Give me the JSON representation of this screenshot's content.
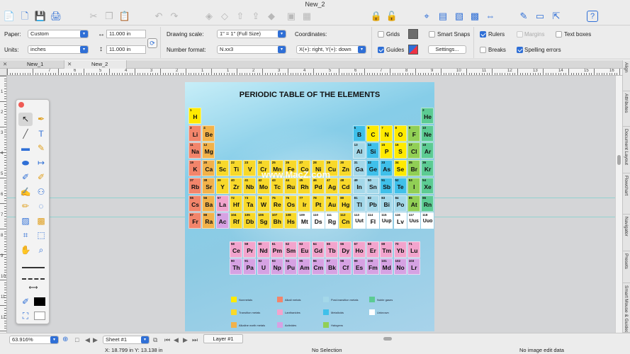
{
  "window": {
    "title": "New_2"
  },
  "props": {
    "paper_label": "Paper:",
    "paper_value": "Custom",
    "width_value": "11.000 in",
    "height_value": "11.000 in",
    "units_label": "Units:",
    "units_value": "inches",
    "drawing_scale_label": "Drawing scale:",
    "drawing_scale_value": "1\" = 1\"   (Full Size)",
    "number_format_label": "Number format:",
    "number_format_value": "N.xx3",
    "coordinates_label": "Coordinates:",
    "coordinates_value": "X(+): right, Y(+): down",
    "grids_label": "Grids",
    "guides_label": "Guides",
    "smart_snaps_label": "Smart Snaps",
    "settings_label": "Settings...",
    "rulers_label": "Rulers",
    "margins_label": "Margins",
    "breaks_label": "Breaks",
    "text_boxes_label": "Text boxes",
    "spelling_label": "Spelling errors",
    "grids_checked": false,
    "guides_checked": true,
    "smart_snaps_checked": false,
    "rulers_checked": true,
    "margins_checked": false,
    "breaks_checked": false,
    "text_boxes_checked": false,
    "spelling_checked": true
  },
  "tabs": [
    {
      "label": "New_1"
    },
    {
      "label": "New_2"
    }
  ],
  "ruler_numbers": [
    "7",
    "6",
    "5",
    "4",
    "3",
    "2",
    "1",
    "1",
    "2",
    "3",
    "4",
    "5",
    "6",
    "7",
    "8",
    "9",
    "10",
    "11",
    "12",
    "13",
    "14",
    "15",
    "16",
    "17",
    "18"
  ],
  "vruler_numbers": [
    "1",
    "2",
    "3",
    "4",
    "5",
    "6",
    "7",
    "8",
    "9",
    "10",
    "11",
    "12"
  ],
  "right_panel": [
    "Align",
    "Attributes",
    "Document Layout",
    "Flowchart",
    "Navigator",
    "Presets",
    "Smart Mouse & Guides"
  ],
  "poster": {
    "title": "PERIODIC TABLE OF THE ELEMENTS",
    "watermark": "www.MacZ.com",
    "colors": {
      "alkali": "#f2856b",
      "alkaline": "#f2b24a",
      "transition": "#f8d92a",
      "post": "#a4d8e9",
      "metalloid": "#3fc0ea",
      "nonmetal": "#ffea00",
      "halogen": "#91cf55",
      "noble": "#5ccb93",
      "lanth": "#f2a4cd",
      "actin": "#d6a2e3",
      "unknown": "#ffffff"
    },
    "elements": [
      {
        "n": "1",
        "s": "H",
        "c": "nonmetal",
        "r": 1,
        "g": 1
      },
      {
        "n": "2",
        "s": "He",
        "c": "noble",
        "r": 1,
        "g": 18
      },
      {
        "n": "3",
        "s": "Li",
        "c": "alkali",
        "r": 2,
        "g": 1
      },
      {
        "n": "4",
        "s": "Be",
        "c": "alkaline",
        "r": 2,
        "g": 2
      },
      {
        "n": "5",
        "s": "B",
        "c": "metalloid",
        "r": 2,
        "g": 13
      },
      {
        "n": "6",
        "s": "C",
        "c": "nonmetal",
        "r": 2,
        "g": 14
      },
      {
        "n": "7",
        "s": "N",
        "c": "nonmetal",
        "r": 2,
        "g": 15
      },
      {
        "n": "8",
        "s": "O",
        "c": "nonmetal",
        "r": 2,
        "g": 16
      },
      {
        "n": "9",
        "s": "F",
        "c": "halogen",
        "r": 2,
        "g": 17
      },
      {
        "n": "10",
        "s": "Ne",
        "c": "noble",
        "r": 2,
        "g": 18
      },
      {
        "n": "11",
        "s": "Na",
        "c": "alkali",
        "r": 3,
        "g": 1
      },
      {
        "n": "12",
        "s": "Mg",
        "c": "alkaline",
        "r": 3,
        "g": 2
      },
      {
        "n": "13",
        "s": "Al",
        "c": "post",
        "r": 3,
        "g": 13
      },
      {
        "n": "14",
        "s": "Si",
        "c": "metalloid",
        "r": 3,
        "g": 14
      },
      {
        "n": "15",
        "s": "P",
        "c": "nonmetal",
        "r": 3,
        "g": 15
      },
      {
        "n": "16",
        "s": "S",
        "c": "nonmetal",
        "r": 3,
        "g": 16
      },
      {
        "n": "17",
        "s": "Cl",
        "c": "halogen",
        "r": 3,
        "g": 17
      },
      {
        "n": "18",
        "s": "Ar",
        "c": "noble",
        "r": 3,
        "g": 18
      },
      {
        "n": "19",
        "s": "K",
        "c": "alkali",
        "r": 4,
        "g": 1
      },
      {
        "n": "20",
        "s": "Ca",
        "c": "alkaline",
        "r": 4,
        "g": 2
      },
      {
        "n": "21",
        "s": "Sc",
        "c": "transition",
        "r": 4,
        "g": 3
      },
      {
        "n": "22",
        "s": "Ti",
        "c": "transition",
        "r": 4,
        "g": 4
      },
      {
        "n": "23",
        "s": "V",
        "c": "transition",
        "r": 4,
        "g": 5
      },
      {
        "n": "24",
        "s": "Cr",
        "c": "transition",
        "r": 4,
        "g": 6
      },
      {
        "n": "25",
        "s": "Mn",
        "c": "transition",
        "r": 4,
        "g": 7
      },
      {
        "n": "26",
        "s": "Fe",
        "c": "transition",
        "r": 4,
        "g": 8
      },
      {
        "n": "27",
        "s": "Co",
        "c": "transition",
        "r": 4,
        "g": 9
      },
      {
        "n": "28",
        "s": "Ni",
        "c": "transition",
        "r": 4,
        "g": 10
      },
      {
        "n": "29",
        "s": "Cu",
        "c": "transition",
        "r": 4,
        "g": 11
      },
      {
        "n": "30",
        "s": "Zn",
        "c": "transition",
        "r": 4,
        "g": 12
      },
      {
        "n": "31",
        "s": "Ga",
        "c": "post",
        "r": 4,
        "g": 13
      },
      {
        "n": "32",
        "s": "Ge",
        "c": "metalloid",
        "r": 4,
        "g": 14
      },
      {
        "n": "33",
        "s": "As",
        "c": "metalloid",
        "r": 4,
        "g": 15
      },
      {
        "n": "34",
        "s": "Se",
        "c": "nonmetal",
        "r": 4,
        "g": 16
      },
      {
        "n": "35",
        "s": "Br",
        "c": "halogen",
        "r": 4,
        "g": 17
      },
      {
        "n": "36",
        "s": "Kr",
        "c": "noble",
        "r": 4,
        "g": 18
      },
      {
        "n": "37",
        "s": "Rb",
        "c": "alkali",
        "r": 5,
        "g": 1
      },
      {
        "n": "38",
        "s": "Sr",
        "c": "alkaline",
        "r": 5,
        "g": 2
      },
      {
        "n": "39",
        "s": "Y",
        "c": "transition",
        "r": 5,
        "g": 3
      },
      {
        "n": "40",
        "s": "Zr",
        "c": "transition",
        "r": 5,
        "g": 4
      },
      {
        "n": "41",
        "s": "Nb",
        "c": "transition",
        "r": 5,
        "g": 5
      },
      {
        "n": "42",
        "s": "Mo",
        "c": "transition",
        "r": 5,
        "g": 6
      },
      {
        "n": "43",
        "s": "Tc",
        "c": "transition",
        "r": 5,
        "g": 7
      },
      {
        "n": "44",
        "s": "Ru",
        "c": "transition",
        "r": 5,
        "g": 8
      },
      {
        "n": "45",
        "s": "Rh",
        "c": "transition",
        "r": 5,
        "g": 9
      },
      {
        "n": "46",
        "s": "Pd",
        "c": "transition",
        "r": 5,
        "g": 10
      },
      {
        "n": "47",
        "s": "Ag",
        "c": "transition",
        "r": 5,
        "g": 11
      },
      {
        "n": "48",
        "s": "Cd",
        "c": "transition",
        "r": 5,
        "g": 12
      },
      {
        "n": "49",
        "s": "In",
        "c": "post",
        "r": 5,
        "g": 13
      },
      {
        "n": "50",
        "s": "Sn",
        "c": "post",
        "r": 5,
        "g": 14
      },
      {
        "n": "51",
        "s": "Sb",
        "c": "metalloid",
        "r": 5,
        "g": 15
      },
      {
        "n": "52",
        "s": "Te",
        "c": "metalloid",
        "r": 5,
        "g": 16
      },
      {
        "n": "53",
        "s": "I",
        "c": "halogen",
        "r": 5,
        "g": 17
      },
      {
        "n": "54",
        "s": "Xe",
        "c": "noble",
        "r": 5,
        "g": 18
      },
      {
        "n": "55",
        "s": "Cs",
        "c": "alkali",
        "r": 6,
        "g": 1
      },
      {
        "n": "56",
        "s": "Ba",
        "c": "alkaline",
        "r": 6,
        "g": 2
      },
      {
        "n": "57",
        "s": "La",
        "c": "lanth",
        "r": 6,
        "g": 3
      },
      {
        "n": "72",
        "s": "Hf",
        "c": "transition",
        "r": 6,
        "g": 4
      },
      {
        "n": "73",
        "s": "Ta",
        "c": "transition",
        "r": 6,
        "g": 5
      },
      {
        "n": "74",
        "s": "W",
        "c": "transition",
        "r": 6,
        "g": 6
      },
      {
        "n": "75",
        "s": "Re",
        "c": "transition",
        "r": 6,
        "g": 7
      },
      {
        "n": "76",
        "s": "Os",
        "c": "transition",
        "r": 6,
        "g": 8
      },
      {
        "n": "77",
        "s": "Ir",
        "c": "transition",
        "r": 6,
        "g": 9
      },
      {
        "n": "78",
        "s": "Pt",
        "c": "transition",
        "r": 6,
        "g": 10
      },
      {
        "n": "79",
        "s": "Au",
        "c": "transition",
        "r": 6,
        "g": 11
      },
      {
        "n": "80",
        "s": "Hg",
        "c": "transition",
        "r": 6,
        "g": 12
      },
      {
        "n": "81",
        "s": "Tl",
        "c": "post",
        "r": 6,
        "g": 13
      },
      {
        "n": "82",
        "s": "Pb",
        "c": "post",
        "r": 6,
        "g": 14
      },
      {
        "n": "83",
        "s": "Bi",
        "c": "post",
        "r": 6,
        "g": 15
      },
      {
        "n": "84",
        "s": "Po",
        "c": "post",
        "r": 6,
        "g": 16
      },
      {
        "n": "85",
        "s": "At",
        "c": "halogen",
        "r": 6,
        "g": 17
      },
      {
        "n": "86",
        "s": "Rn",
        "c": "noble",
        "r": 6,
        "g": 18
      },
      {
        "n": "87",
        "s": "Fr",
        "c": "alkali",
        "r": 7,
        "g": 1
      },
      {
        "n": "88",
        "s": "Ra",
        "c": "alkaline",
        "r": 7,
        "g": 2
      },
      {
        "n": "89",
        "s": "Ac",
        "c": "actin",
        "r": 7,
        "g": 3
      },
      {
        "n": "104",
        "s": "Rf",
        "c": "transition",
        "r": 7,
        "g": 4
      },
      {
        "n": "105",
        "s": "Db",
        "c": "transition",
        "r": 7,
        "g": 5
      },
      {
        "n": "106",
        "s": "Sg",
        "c": "transition",
        "r": 7,
        "g": 6
      },
      {
        "n": "107",
        "s": "Bh",
        "c": "transition",
        "r": 7,
        "g": 7
      },
      {
        "n": "108",
        "s": "Hs",
        "c": "transition",
        "r": 7,
        "g": 8
      },
      {
        "n": "109",
        "s": "Mt",
        "c": "unknown",
        "r": 7,
        "g": 9
      },
      {
        "n": "110",
        "s": "Ds",
        "c": "unknown",
        "r": 7,
        "g": 10
      },
      {
        "n": "111",
        "s": "Rg",
        "c": "unknown",
        "r": 7,
        "g": 11
      },
      {
        "n": "112",
        "s": "Cn",
        "c": "transition",
        "r": 7,
        "g": 12
      },
      {
        "n": "113",
        "s": "Uut",
        "c": "unknown",
        "r": 7,
        "g": 13
      },
      {
        "n": "114",
        "s": "Fl",
        "c": "unknown",
        "r": 7,
        "g": 14
      },
      {
        "n": "115",
        "s": "Uup",
        "c": "unknown",
        "r": 7,
        "g": 15
      },
      {
        "n": "116",
        "s": "Lv",
        "c": "unknown",
        "r": 7,
        "g": 16
      },
      {
        "n": "117",
        "s": "Uus",
        "c": "unknown",
        "r": 7,
        "g": 17
      },
      {
        "n": "118",
        "s": "Uuo",
        "c": "unknown",
        "r": 7,
        "g": 18
      },
      {
        "n": "58",
        "s": "Ce",
        "c": "lanth",
        "r": 9,
        "g": 4
      },
      {
        "n": "59",
        "s": "Pr",
        "c": "lanth",
        "r": 9,
        "g": 5
      },
      {
        "n": "60",
        "s": "Nd",
        "c": "lanth",
        "r": 9,
        "g": 6
      },
      {
        "n": "61",
        "s": "Pm",
        "c": "lanth",
        "r": 9,
        "g": 7
      },
      {
        "n": "62",
        "s": "Sm",
        "c": "lanth",
        "r": 9,
        "g": 8
      },
      {
        "n": "63",
        "s": "Eu",
        "c": "lanth",
        "r": 9,
        "g": 9
      },
      {
        "n": "64",
        "s": "Gd",
        "c": "lanth",
        "r": 9,
        "g": 10
      },
      {
        "n": "65",
        "s": "Tb",
        "c": "lanth",
        "r": 9,
        "g": 11
      },
      {
        "n": "66",
        "s": "Dy",
        "c": "lanth",
        "r": 9,
        "g": 12
      },
      {
        "n": "67",
        "s": "Ho",
        "c": "lanth",
        "r": 9,
        "g": 13
      },
      {
        "n": "68",
        "s": "Er",
        "c": "lanth",
        "r": 9,
        "g": 14
      },
      {
        "n": "69",
        "s": "Tm",
        "c": "lanth",
        "r": 9,
        "g": 15
      },
      {
        "n": "70",
        "s": "Yb",
        "c": "lanth",
        "r": 9,
        "g": 16
      },
      {
        "n": "71",
        "s": "Lu",
        "c": "lanth",
        "r": 9,
        "g": 17
      },
      {
        "n": "90",
        "s": "Th",
        "c": "actin",
        "r": 10,
        "g": 4
      },
      {
        "n": "91",
        "s": "Pa",
        "c": "actin",
        "r": 10,
        "g": 5
      },
      {
        "n": "92",
        "s": "U",
        "c": "actin",
        "r": 10,
        "g": 6
      },
      {
        "n": "93",
        "s": "Np",
        "c": "actin",
        "r": 10,
        "g": 7
      },
      {
        "n": "94",
        "s": "Pu",
        "c": "actin",
        "r": 10,
        "g": 8
      },
      {
        "n": "95",
        "s": "Am",
        "c": "actin",
        "r": 10,
        "g": 9
      },
      {
        "n": "96",
        "s": "Cm",
        "c": "actin",
        "r": 10,
        "g": 10
      },
      {
        "n": "97",
        "s": "Bk",
        "c": "actin",
        "r": 10,
        "g": 11
      },
      {
        "n": "98",
        "s": "Cf",
        "c": "actin",
        "r": 10,
        "g": 12
      },
      {
        "n": "99",
        "s": "Es",
        "c": "actin",
        "r": 10,
        "g": 13
      },
      {
        "n": "100",
        "s": "Fm",
        "c": "actin",
        "r": 10,
        "g": 14
      },
      {
        "n": "101",
        "s": "Md",
        "c": "actin",
        "r": 10,
        "g": 15
      },
      {
        "n": "102",
        "s": "No",
        "c": "actin",
        "r": 10,
        "g": 16
      },
      {
        "n": "103",
        "s": "Lr",
        "c": "actin",
        "r": 10,
        "g": 17
      }
    ],
    "legend": [
      {
        "label": "Nonmetals",
        "c": "nonmetal"
      },
      {
        "label": "Alkali metals",
        "c": "alkali"
      },
      {
        "label": "Post-transition metals",
        "c": "post"
      },
      {
        "label": "Noble gases",
        "c": "noble"
      },
      {
        "label": "Transition metals",
        "c": "transition"
      },
      {
        "label": "Lanthanides",
        "c": "lanth"
      },
      {
        "label": "Metalloids",
        "c": "metalloid"
      },
      {
        "label": "Unknown",
        "c": "unknown"
      },
      {
        "label": "Alkaline earth metals",
        "c": "alkaline"
      },
      {
        "label": "Actinides",
        "c": "actin"
      },
      {
        "label": "Halogens",
        "c": "halogen"
      }
    ]
  },
  "toolbar_icons": [
    "new-icon",
    "new-document-icon",
    "save-icon",
    "print-icon",
    "cut-icon",
    "copy-icon",
    "paste-icon",
    "undo-icon",
    "redo-icon",
    "layer-icon",
    "layer-down-icon",
    "layer-up-icon",
    "layer-front-icon",
    "layer-back-icon",
    "group-icon",
    "ungroup-icon",
    "lock-icon",
    "unlock-icon",
    "dimension-icon",
    "table-icon",
    "image-icon",
    "shape-icon",
    "link-icon",
    "edit-icon",
    "display-icon",
    "share-icon",
    "help-icon"
  ],
  "status": {
    "zoom": "63.916%",
    "sheet": "Sheet #1",
    "layer": "Layer #1",
    "coords": "X: 18.799 in   Y: 13.138 in",
    "selection": "No Selection",
    "image_edit": "No image edit data"
  }
}
